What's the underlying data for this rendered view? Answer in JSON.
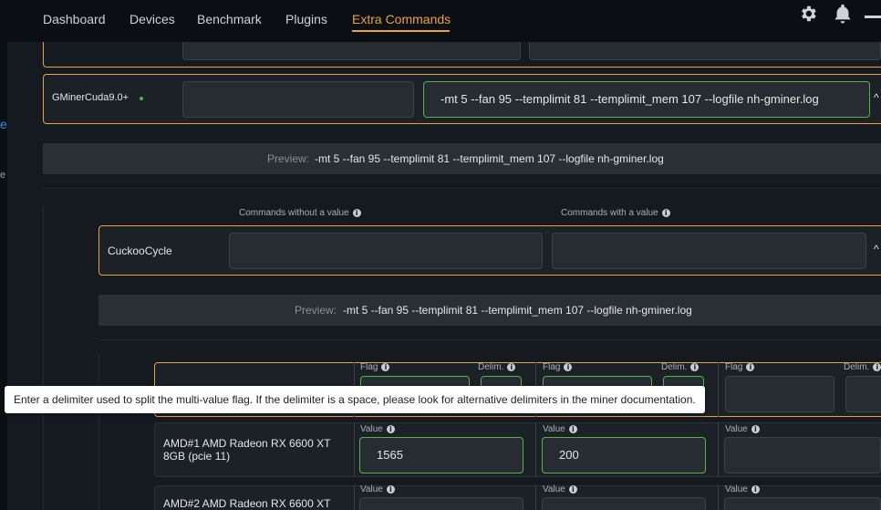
{
  "nav": {
    "items": [
      {
        "label": "Dashboard"
      },
      {
        "label": "Devices"
      },
      {
        "label": "Benchmark"
      },
      {
        "label": "Plugins"
      },
      {
        "label": "Extra Commands"
      }
    ],
    "active": "Extra Commands",
    "accent": "#e9a33c"
  },
  "side_strip": {
    "text_1": "e",
    "text_2": "e"
  },
  "gminer": {
    "name": "GMinerCuda9.0+",
    "status_dot_color": "#57b346",
    "without_value": "",
    "with_value": "-mt 5 --fan 95 --templimit 81 --templimit_mem 107 --logfile nh-gminer.log",
    "preview_label": "Preview:",
    "preview_value": "-mt 5 --fan 95 --templimit 81 --templimit_mem 107 --logfile nh-gminer.log"
  },
  "cuckoo": {
    "col_without": "Commands without a value",
    "col_with": "Commands with a value",
    "name": "CuckooCycle",
    "without_value": "",
    "with_value": "",
    "preview_label": "Preview:",
    "preview_value": "-mt 5 --fan 95 --templimit 81 --templimit_mem 107 --logfile nh-gminer.log"
  },
  "flags": {
    "flag_label": "Flag",
    "delim_label": "Delim.",
    "value_label": "Value"
  },
  "tooltip": "Enter a delimiter used to split the multi-value flag. If the delimiter is a space, please look for alternative delimiters in the miner documentation.",
  "devices": [
    {
      "name": "AMD#1 AMD Radeon RX 6600 XT 8GB (pcie 11)",
      "values": [
        "1565",
        "200",
        ""
      ]
    },
    {
      "name": "AMD#2 AMD Radeon RX 6600 XT",
      "values": [
        "",
        "",
        ""
      ]
    }
  ]
}
